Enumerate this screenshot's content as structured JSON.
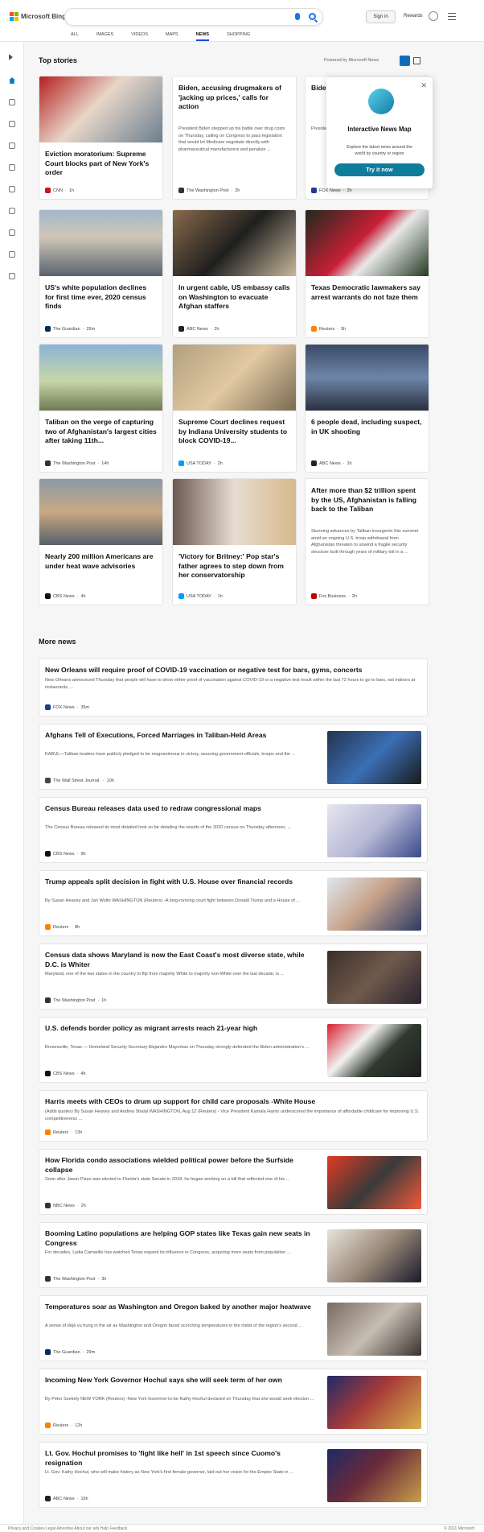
{
  "header": {
    "logo_text": "Microsoft Bing",
    "search_placeholder": "",
    "sign_in": "Sign in",
    "rewards": "Rewards"
  },
  "tabs": [
    {
      "label": "ALL",
      "active": false
    },
    {
      "label": "IMAGES",
      "active": false
    },
    {
      "label": "VIDEOS",
      "active": false
    },
    {
      "label": "MAPS",
      "active": false
    },
    {
      "label": "NEWS",
      "active": true
    },
    {
      "label": "SHOPPING",
      "active": false
    }
  ],
  "sidebar_icons": [
    "expand-icon",
    "home-icon",
    "ev-charger-icon",
    "flag-icon",
    "location-pin-icon",
    "globe-icon",
    "science-icon",
    "rocket-icon",
    "film-icon",
    "bank-icon",
    "id-card-icon"
  ],
  "top_stories": {
    "title": "Top stories",
    "powered_by": "Powered by Microsoft News",
    "cards": [
      {
        "title": "Eviction moratorium: Supreme Court blocks part of New York's order",
        "snippet": "",
        "source": "CNN",
        "time": "1h",
        "has_image": true,
        "color": "#c4161c"
      },
      {
        "title": "Biden, accusing drugmakers of 'jacking up prices,' calls for action",
        "snippet": "President Biden stepped up his battle over drug costs on Thursday, calling on Congress to pass legislation that would let Medicare negotiate directly with pharmaceutical manufacturers and penalize ...",
        "source": "The Washington Post",
        "time": "2h",
        "has_image": false,
        "color": "#333333"
      },
      {
        "title": "Biden 'overre... 'high...",
        "snippet": "Preside... possibi... through... they ar... questio...",
        "source": "FOX News",
        "time": "2h",
        "has_image": false,
        "color": "#1f3a93"
      },
      {
        "title": "US's white population declines for first time ever, 2020 census finds",
        "snippet": "",
        "source": "The Guardian",
        "time": "29m",
        "has_image": true,
        "color": "#052962"
      },
      {
        "title": "In urgent cable, US embassy calls on Washington to evacuate Afghan staffers",
        "snippet": "",
        "source": "ABC News",
        "time": "2h",
        "has_image": true,
        "color": "#222222"
      },
      {
        "title": "Texas Democratic lawmakers say arrest warrants do not faze them",
        "snippet": "",
        "source": "Reuters",
        "time": "5h",
        "has_image": true,
        "color": "#ff8000"
      },
      {
        "title": "Taliban on the verge of capturing two of Afghanistan's largest cities after taking 11th...",
        "snippet": "",
        "source": "The Washington Post",
        "time": "14h",
        "has_image": true,
        "color": "#333333"
      },
      {
        "title": "Supreme Court declines request by Indiana University students to block COVID-19...",
        "snippet": "",
        "source": "USA TODAY",
        "time": "2h",
        "has_image": true,
        "color": "#009bff"
      },
      {
        "title": "6 people dead, including suspect, in UK shooting",
        "snippet": "",
        "source": "ABC News",
        "time": "1h",
        "has_image": true,
        "color": "#222222"
      },
      {
        "title": "Nearly 200 million Americans are under heat wave advisories",
        "snippet": "",
        "source": "CBS News",
        "time": "4h",
        "has_image": true,
        "color": "#111111"
      },
      {
        "title": "'Victory for Britney:' Pop star's father agrees to step down from her conservatorship",
        "snippet": "",
        "source": "USA TODAY",
        "time": "1h",
        "has_image": true,
        "color": "#009bff"
      },
      {
        "title": "After more than $2 trillion spent by the US, Afghanistan is falling back to the Taliban",
        "snippet": "Stunning advances by Taliban insurgents this summer amid an ongoing U.S. troop withdrawal from Afghanistan threaten to unwind a fragile security structure built through years of military toil in a ...",
        "source": "Fox Business",
        "time": "2h",
        "has_image": false,
        "color": "#c00000"
      }
    ]
  },
  "popup": {
    "title": "Interactive News Map",
    "description": "Explore the latest news around the world by country or region",
    "button": "Try it now"
  },
  "more_news": {
    "title": "More news",
    "items": [
      {
        "title": "New Orleans will require proof of COVID-19 vaccination or negative test for bars, gyms, concerts",
        "snippet": "New Orleans announced Thursday that people will have to show either proof of vaccination against COVID-19 or a negative test result within the last 72 hours to go to bars, eat indoors at restaurants, ...",
        "source": "FOX News",
        "time": "35m",
        "has_image": false,
        "color": "#1f3a93"
      },
      {
        "title": "Afghans Tell of Executions, Forced Marriages in Taliban-Held Areas",
        "snippet": "KABUL—Taliban leaders have publicly pledged to be magnanimous in victory, assuring government officials, troops and the ...",
        "source": "The Wall Street Journal.",
        "time": "10h",
        "has_image": true,
        "color": "#444444"
      },
      {
        "title": "Census Bureau releases data used to redraw congressional maps",
        "snippet": "The Census Bureau released its most detailed look so far detailing the results of the 2020 census on Thursday afternoon, ...",
        "source": "CBS News",
        "time": "9h",
        "has_image": true,
        "color": "#111111"
      },
      {
        "title": "Trump appeals split decision in fight with U.S. House over financial records",
        "snippet": "By Susan Heavey and Jan Wolfe WASHINGTON (Reuters) -A long-running court fight between Donald Trump and a House of ...",
        "source": "Reuters",
        "time": "8h",
        "has_image": true,
        "color": "#ff8000"
      },
      {
        "title": "Census data shows Maryland is now the East Coast's most diverse state, while D.C. is Whiter",
        "snippet": "Maryland, one of the two states in the country to flip from majority White to majority non-White over the last decade, is ...",
        "source": "The Washington Post",
        "time": "1h",
        "has_image": true,
        "color": "#333333"
      },
      {
        "title": "U.S. defends border policy as migrant arrests reach 21-year high",
        "snippet": "Brownsville, Texas — Homeland Security Secretary Alejandro Mayorkas on Thursday strongly defended the Biden administration's ...",
        "source": "CBS News",
        "time": "4h",
        "has_image": true,
        "color": "#111111"
      },
      {
        "title": "Harris meets with CEOs to drum up support for child care proposals -White House",
        "snippet": "(Adds quotes) By Susan Heavey and Andrea Shalal WASHINGTON, Aug 12 (Reuters) - Vice President Kamala Harris underscored the importance of affordable childcare for improving U.S. competitiveness ...",
        "source": "Reuters",
        "time": "13h",
        "has_image": false,
        "color": "#ff8000"
      },
      {
        "title": "How Florida condo associations wielded political power before the Surfside collapse",
        "snippet": "Soon after Jason Pizzo was elected to Florida's state Senate in 2018, he began working on a bill that reflected one of his ...",
        "source": "NBC News",
        "time": "2h",
        "has_image": true,
        "color": "#333333"
      },
      {
        "title": "Booming Latino populations are helping GOP states like Texas gain new seats in Congress",
        "snippet": "For decades, Lydia Camarillo has watched Texas expand its influence in Congress, acquiring more seats from population ...",
        "source": "The Washington Post",
        "time": "3h",
        "has_image": true,
        "color": "#333333"
      },
      {
        "title": "Temperatures soar as Washington and Oregon baked by another major heatwave",
        "snippet": "A sense of déjà vu hung in the air as Washington and Oregon faced scorching temperatures in the midst of the region's second ...",
        "source": "The Guardian",
        "time": "29m",
        "has_image": true,
        "color": "#052962"
      },
      {
        "title": "Incoming New York Governor Hochul says she will seek term of her own",
        "snippet": "By Peter Szekely NEW YORK (Reuters) -New York Governor-to-be Kathy Hochul declared on Thursday that she would seek election ...",
        "source": "Reuters",
        "time": "12h",
        "has_image": true,
        "color": "#ff8000"
      },
      {
        "title": "Lt. Gov. Hochul promises to 'fight like hell' in 1st speech since Cuomo's resignation",
        "snippet": "Lt. Gov. Kathy Hochul, who will make history as New York's first female governor, laid out her vision for the Empire State in ...",
        "source": "ABC News",
        "time": "15h",
        "has_image": true,
        "color": "#222222"
      }
    ]
  },
  "footer": {
    "left": "Privacy and Cookies   Legal   Advertise   About our ads   Help   Feedback",
    "right": "© 2021 Microsoft"
  }
}
